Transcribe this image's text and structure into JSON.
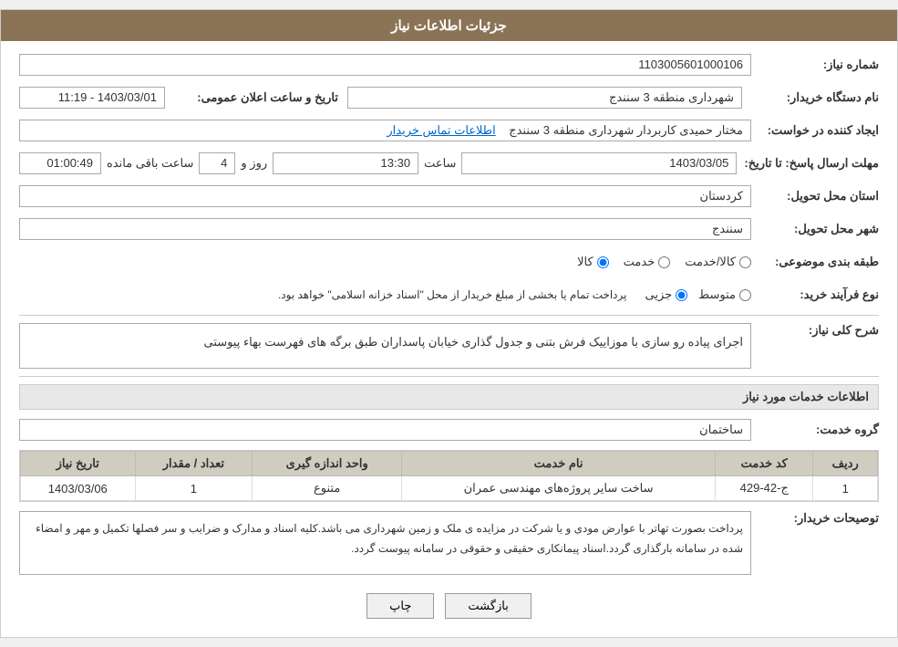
{
  "header": {
    "title": "جزئیات اطلاعات نیاز"
  },
  "fields": {
    "need_number_label": "شماره نیاز:",
    "need_number_value": "1103005601000106",
    "buyer_org_label": "نام دستگاه خریدار:",
    "buyer_org_value": "شهرداری منطقه 3 سنندج",
    "creator_label": "ایجاد کننده در خواست:",
    "creator_value": "مختار حمیدی کاربردار شهرداری منطقه 3 سنندج",
    "creator_link": "اطلاعات تماس خریدار",
    "announce_datetime_label": "تاریخ و ساعت اعلان عمومی:",
    "announce_datetime_value": "1403/03/01 - 11:19",
    "response_deadline_label": "مهلت ارسال پاسخ: تا تاریخ:",
    "response_date": "1403/03/05",
    "response_time_label": "ساعت",
    "response_time": "13:30",
    "response_days_label": "روز و",
    "response_days": "4",
    "remaining_label": "ساعت باقی مانده",
    "remaining_time": "01:00:49",
    "province_label": "استان محل تحویل:",
    "province_value": "کردستان",
    "city_label": "شهر محل تحویل:",
    "city_value": "سنندج",
    "category_label": "طبقه بندی موضوعی:",
    "category_radio_kala": "کالا",
    "category_radio_khedmat": "خدمت",
    "category_radio_kala_khedmat": "کالا/خدمت",
    "purchase_type_label": "نوع فرآیند خرید:",
    "purchase_type_jozi": "جزیی",
    "purchase_type_motawaset": "متوسط",
    "purchase_type_description": "پرداخت تمام یا بخشی از مبلغ خریدار از محل \"اسناد خزانه اسلامی\" خواهد بود.",
    "need_description_label": "شرح کلی نیاز:",
    "need_description_value": "اجرای پیاده رو سازی با موزاییک فرش بتنی و جدول گذاری خیابان پاسداران طبق برگه های فهرست بهاء پیوستی",
    "services_section_title": "اطلاعات خدمات مورد نیاز",
    "service_group_label": "گروه خدمت:",
    "service_group_value": "ساختمان",
    "table": {
      "columns": [
        "ردیف",
        "کد خدمت",
        "نام خدمت",
        "واحد اندازه گیری",
        "تعداد / مقدار",
        "تاریخ نیاز"
      ],
      "rows": [
        {
          "row": "1",
          "service_code": "ج-42-429",
          "service_name": "ساخت سایر پروژه‌های مهندسی عمران",
          "unit": "متنوع",
          "quantity": "1",
          "date": "1403/03/06"
        }
      ]
    },
    "buyer_notes_label": "توصیحات خریدار:",
    "buyer_notes_value": "پرداخت بصورت تهاتر با عوارض مودی و یا شرکت در مزایده ی ملک و زمین شهرداری می باشد.کلیه اسناد و مدارک و ضرایب و سر فصلها تکمیل و مهر و امضاء شده در سامانه بارگذاری گردد.اسناد پیمانکاری حقیقی و حقوقی در سامانه پیوست گردد.",
    "btn_print": "چاپ",
    "btn_back": "بازگشت"
  }
}
